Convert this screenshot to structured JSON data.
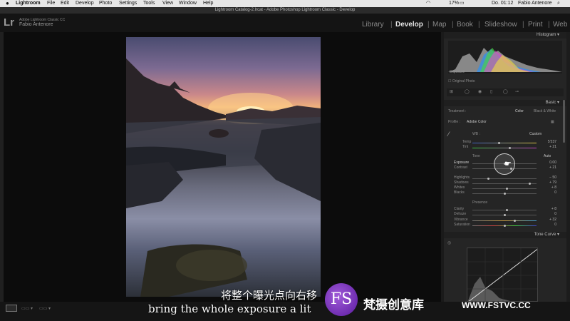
{
  "menubar": {
    "apple": "",
    "items": [
      "Lightroom",
      "File",
      "Edit",
      "Develop",
      "Photo",
      "Settings",
      "Tools",
      "View",
      "Window",
      "Help"
    ],
    "battery": "17%",
    "clock": "Do. 01:12",
    "user": "Fabio Antenore"
  },
  "window": {
    "title": "Lightroom Catalog-2.lrcat - Adobe Photoshop Lightroom Classic - Develop"
  },
  "identity": {
    "logo": "Lr",
    "product": "Adobe Lightroom Classic CC",
    "user": "Fabio Antenore"
  },
  "modules": [
    "Library",
    "Develop",
    "Map",
    "Book",
    "Slideshow",
    "Print",
    "Web"
  ],
  "active_module": "Develop",
  "panels": {
    "histogram": "Histogram",
    "hist_label": "Exposure",
    "original_photo": "Original Photo",
    "basic": "Basic",
    "treatment": "Treatment :",
    "treatment_color": "Color",
    "treatment_bw": "Black & White",
    "profile": "Profile :",
    "profile_value": "Adobe Color",
    "wb": "WB :",
    "wb_value": "Custom",
    "tone": "Tone",
    "auto": "Auto",
    "presence": "Presence",
    "tone_curve": "Tone Curve"
  },
  "sliders": {
    "temp": {
      "label": "Temp",
      "value": "5'237",
      "level": 0.42
    },
    "tint": {
      "label": "Tint",
      "value": "+ 21",
      "level": 0.58
    },
    "exposure": {
      "label": "Exposure",
      "value": "0.00",
      "level": 0.5
    },
    "contrast": {
      "label": "Contrast",
      "value": "+ 21",
      "level": 0.6
    },
    "highlights": {
      "label": "Highlights",
      "value": "− 50",
      "level": 0.25
    },
    "shadows": {
      "label": "Shadows",
      "value": "+ 79",
      "level": 0.89
    },
    "whites": {
      "label": "Whites",
      "value": "+ 8",
      "level": 0.54
    },
    "blacks": {
      "label": "Blacks",
      "value": "0",
      "level": 0.5
    },
    "clarity": {
      "label": "Clarity",
      "value": "+ 8",
      "level": 0.54
    },
    "dehaze": {
      "label": "Dehaze",
      "value": "0",
      "level": 0.5
    },
    "vibrance": {
      "label": "Vibrance",
      "value": "+ 32",
      "level": 0.66
    },
    "saturation": {
      "label": "Saturation",
      "value": "0",
      "level": 0.5
    }
  },
  "subtitles": {
    "zh": "将整个曝光点向右移",
    "en": "bring the whole exposure a lit"
  },
  "watermark": {
    "logo": "FS",
    "text": "梵摄创意库",
    "url": "WWW.FSTVC.CC"
  },
  "colors": {
    "accent": "#e6e6e6",
    "panel": "#252525",
    "watermark": "#7a2fc0"
  }
}
